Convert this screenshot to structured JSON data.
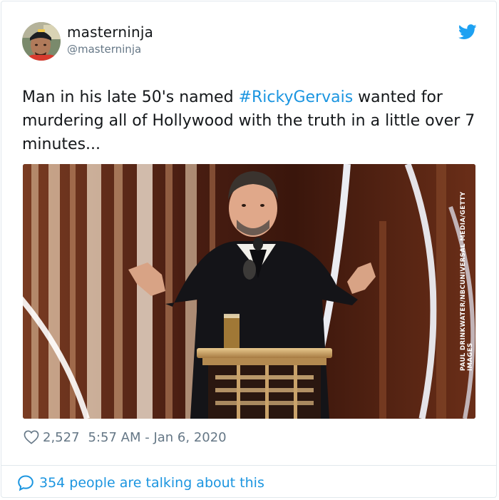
{
  "user": {
    "display_name": "masterninja",
    "handle": "@masterninja"
  },
  "tweet": {
    "text_before": "Man in his late 50's named ",
    "hashtag": "#RickyGervais",
    "text_after": " wanted for murdering all of Hollywood with the truth in a little over 7 minutes..."
  },
  "media": {
    "photo_credit": "PAUL DRINKWATER/NBCUNIVERSAL MEDIA/GETTY IMAGES"
  },
  "footer": {
    "like_count": "2,527",
    "timestamp": "5:57 AM - Jan 6, 2020"
  },
  "conversation": {
    "label": "354 people are talking about this"
  },
  "colors": {
    "accent": "#1b95e0",
    "twitter_blue": "#1da1f2",
    "secondary_text": "#657786",
    "border": "#e1e8ed"
  },
  "icons": {
    "brand": "twitter-bird-icon",
    "like": "heart-icon",
    "reply": "speech-bubble-icon"
  }
}
